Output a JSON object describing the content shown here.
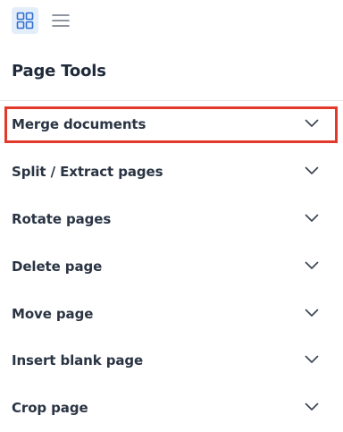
{
  "toolbar": {
    "grid_view_icon": "grid-icon",
    "list_view_icon": "hamburger-menu-icon",
    "accent_bg": "#e4eefb",
    "accent_color": "#2f6fd1"
  },
  "panel": {
    "title": "Page Tools"
  },
  "tools": [
    {
      "label": "Merge documents",
      "icon": "chevron-down-icon"
    },
    {
      "label": "Split / Extract pages",
      "icon": "chevron-down-icon"
    },
    {
      "label": "Rotate pages",
      "icon": "chevron-down-icon"
    },
    {
      "label": "Delete page",
      "icon": "chevron-down-icon"
    },
    {
      "label": "Move page",
      "icon": "chevron-down-icon"
    },
    {
      "label": "Insert blank page",
      "icon": "chevron-down-icon"
    },
    {
      "label": "Crop page",
      "icon": "chevron-down-icon"
    }
  ],
  "highlight": {
    "target": "Merge documents",
    "color": "#e23a2a"
  }
}
